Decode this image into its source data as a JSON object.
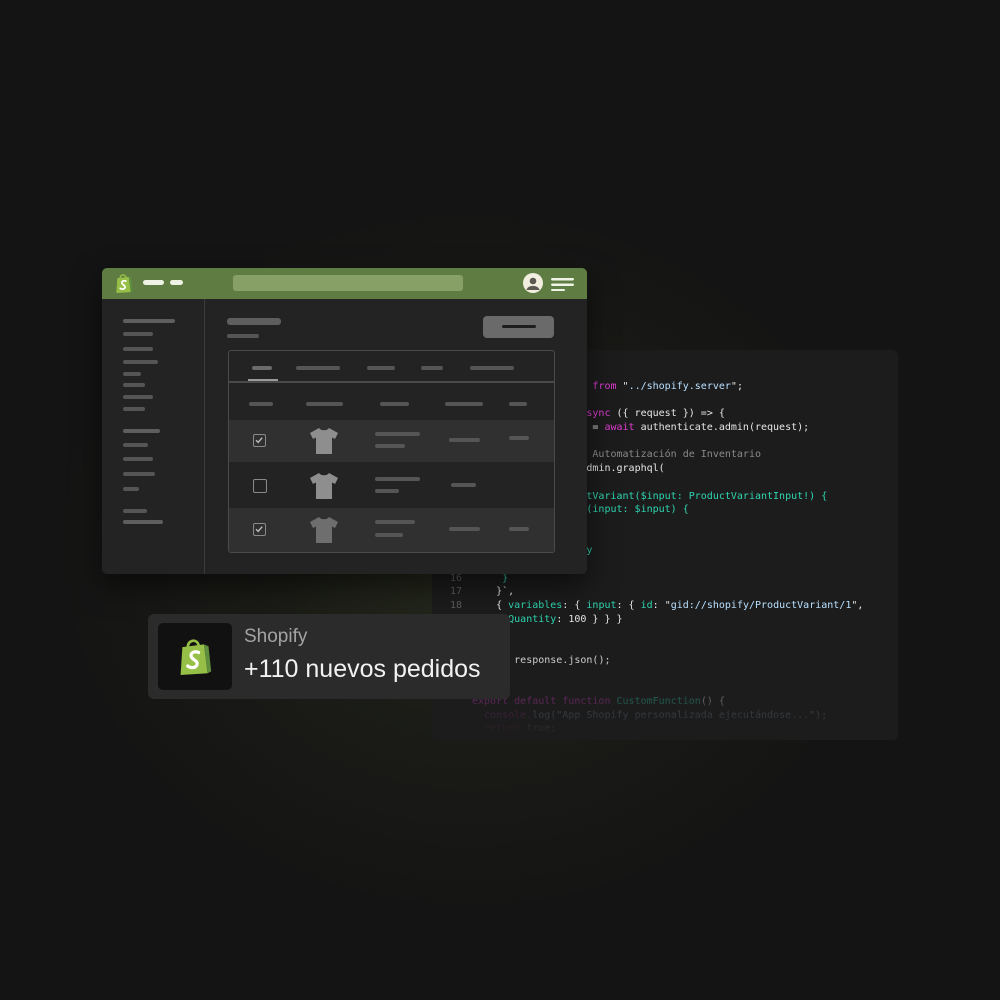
{
  "code": {
    "lines": [
      {
        "n": "",
        "tokens": [
          {
            "t": "                  } ",
            "c": "id"
          },
          {
            "t": "from",
            "c": "kw"
          },
          {
            "t": " \"",
            "c": "id"
          },
          {
            "t": "../shopify.server",
            "c": "str"
          },
          {
            "t": "\";",
            "c": "id"
          }
        ]
      },
      {
        "n": "",
        "tokens": []
      },
      {
        "n": "",
        "tokens": [
          {
            "t": "                  ",
            "c": "id"
          },
          {
            "t": "async",
            "c": "kw"
          },
          {
            "t": " ({ request }) => {",
            "c": "id"
          }
        ]
      },
      {
        "n": "",
        "tokens": [
          {
            "t": "              ion } = ",
            "c": "id"
          },
          {
            "t": "await",
            "c": "kw"
          },
          {
            "t": " authenticate.admin(request);",
            "c": "id"
          }
        ]
      },
      {
        "n": "",
        "tokens": []
      },
      {
        "n": "",
        "tokens": [
          {
            "t": "              ERP / Automatización de Inventario",
            "c": "cm"
          }
        ]
      },
      {
        "n": "",
        "tokens": [
          {
            "t": "              ",
            "c": "id"
          },
          {
            "t": "ait",
            "c": "kw"
          },
          {
            "t": " admin.graphql(",
            "c": "id"
          }
        ]
      },
      {
        "n": "",
        "tokens": []
      },
      {
        "n": "",
        "tokens": [
          {
            "t": "              roductVariant($input: ProductVariantInput!) {",
            "c": "fn"
          }
        ]
      },
      {
        "n": "",
        "tokens": [
          {
            "t": "              pdate(input: $input) {",
            "c": "fn"
          }
        ]
      },
      {
        "n": "",
        "tokens": [
          {
            "t": "              t {",
            "c": "fn"
          }
        ]
      },
      {
        "n": "",
        "tokens": []
      },
      {
        "n": "",
        "tokens": [
          {
            "t": "              antity",
            "c": "fn"
          }
        ]
      },
      {
        "n": "",
        "tokens": []
      },
      {
        "n": "16",
        "tokens": [
          {
            "t": "     }",
            "c": "fn"
          }
        ]
      },
      {
        "n": "17",
        "tokens": [
          {
            "t": "    }`,",
            "c": "id"
          }
        ]
      },
      {
        "n": "18",
        "tokens": [
          {
            "t": "    { ",
            "c": "id"
          },
          {
            "t": "variables",
            "c": "fn"
          },
          {
            "t": ": { ",
            "c": "id"
          },
          {
            "t": "input",
            "c": "fn"
          },
          {
            "t": ": { ",
            "c": "id"
          },
          {
            "t": "id",
            "c": "fn"
          },
          {
            "t": ": \"",
            "c": "id"
          },
          {
            "t": "gid://shopify/ProductVariant/1",
            "c": "str"
          },
          {
            "t": "\",",
            "c": "id"
          }
        ]
      },
      {
        "n": "",
        "tokens": [
          {
            "t": "    ",
            "c": "id"
          },
          {
            "t": "ryQuantity",
            "c": "fn"
          },
          {
            "t": ": 100 } } }",
            "c": "id"
          }
        ]
      },
      {
        "n": "",
        "tokens": []
      },
      {
        "n": "",
        "tokens": []
      },
      {
        "n": "",
        "tokens": [
          {
            "t": "     ",
            "c": "id"
          },
          {
            "t": "n",
            "c": "kw"
          },
          {
            "t": " response.json();",
            "c": "id"
          }
        ]
      },
      {
        "n": "",
        "tokens": []
      },
      {
        "n": "",
        "tokens": []
      },
      {
        "n": "",
        "tokens": [
          {
            "t": "export default function",
            "c": "kw"
          },
          {
            "t": " ",
            "c": "id"
          },
          {
            "t": "CustomFunction",
            "c": "fn"
          },
          {
            "t": "() {",
            "c": "id"
          }
        ]
      },
      {
        "n": "",
        "tokens": [
          {
            "t": "  console.",
            "c": "kw"
          },
          {
            "t": "log(\"App Shopify personalizada ejecutándose...\");",
            "c": "str"
          }
        ]
      },
      {
        "n": "",
        "tokens": [
          {
            "t": "  return",
            "c": "kw"
          },
          {
            "t": " true;",
            "c": "id"
          }
        ]
      }
    ]
  },
  "notification": {
    "title": "Shopify",
    "body": "+110 nuevos pedidos"
  },
  "admin": {
    "rows": [
      {
        "checked": true
      },
      {
        "checked": false
      },
      {
        "checked": true
      }
    ]
  },
  "colors": {
    "topbar": "#5f7c42",
    "shopify_green": "#95bf47",
    "keyword": "#e23bd4",
    "function": "#2fd6b1"
  },
  "icons": {
    "logo": "shopify-bag-icon",
    "avatar": "user-avatar-icon",
    "menu": "hamburger-icon",
    "product": "tshirt-icon",
    "check": "checkbox-icon"
  }
}
